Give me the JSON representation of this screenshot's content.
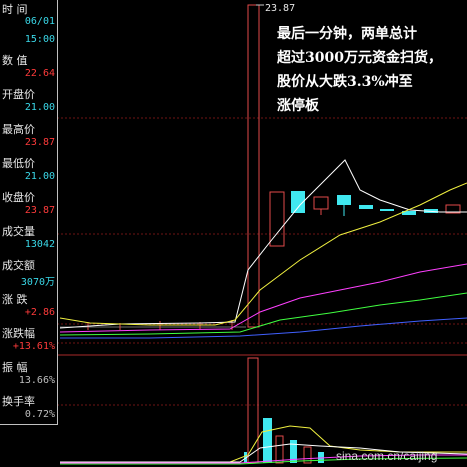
{
  "info_panel": {
    "time_label": "时 间",
    "date": "06/01",
    "time": "15:00",
    "value_label": "数 值",
    "value": "22.64",
    "open_label": "开盘价",
    "open": "21.00",
    "high_label": "最高价",
    "high": "23.87",
    "low_label": "最低价",
    "low": "21.00",
    "close_label": "收盘价",
    "close": "23.87",
    "volume_label": "成交量",
    "volume": "13042",
    "amount_label": "成交额",
    "amount": "3070万",
    "change_label": "涨 跌",
    "change": "+2.86",
    "change_pct_label": "涨跌幅",
    "change_pct": "+13.61%",
    "amplitude_label": "振 幅",
    "amplitude": "13.66%",
    "turnover_label": "换手率",
    "turnover": "0.72%"
  },
  "chart": {
    "high_marker": "23.87",
    "annotation": [
      "最后一分钟，两单总计",
      "超过3000万元资金扫货，",
      "股价从大跌3.3%冲至",
      "涨停板"
    ]
  },
  "watermark": "sina.com.cn/caijing",
  "colors": {
    "background": "#000000",
    "candle_up": "#e24a4a",
    "candle_down": "#40e8f0",
    "ma_white": "#ffffff",
    "ma_yellow": "#f0f040",
    "ma_magenta": "#ff40ff",
    "ma_green": "#40ff40",
    "ma_blue": "#4060ff",
    "grid": "#7a1a1a"
  }
}
